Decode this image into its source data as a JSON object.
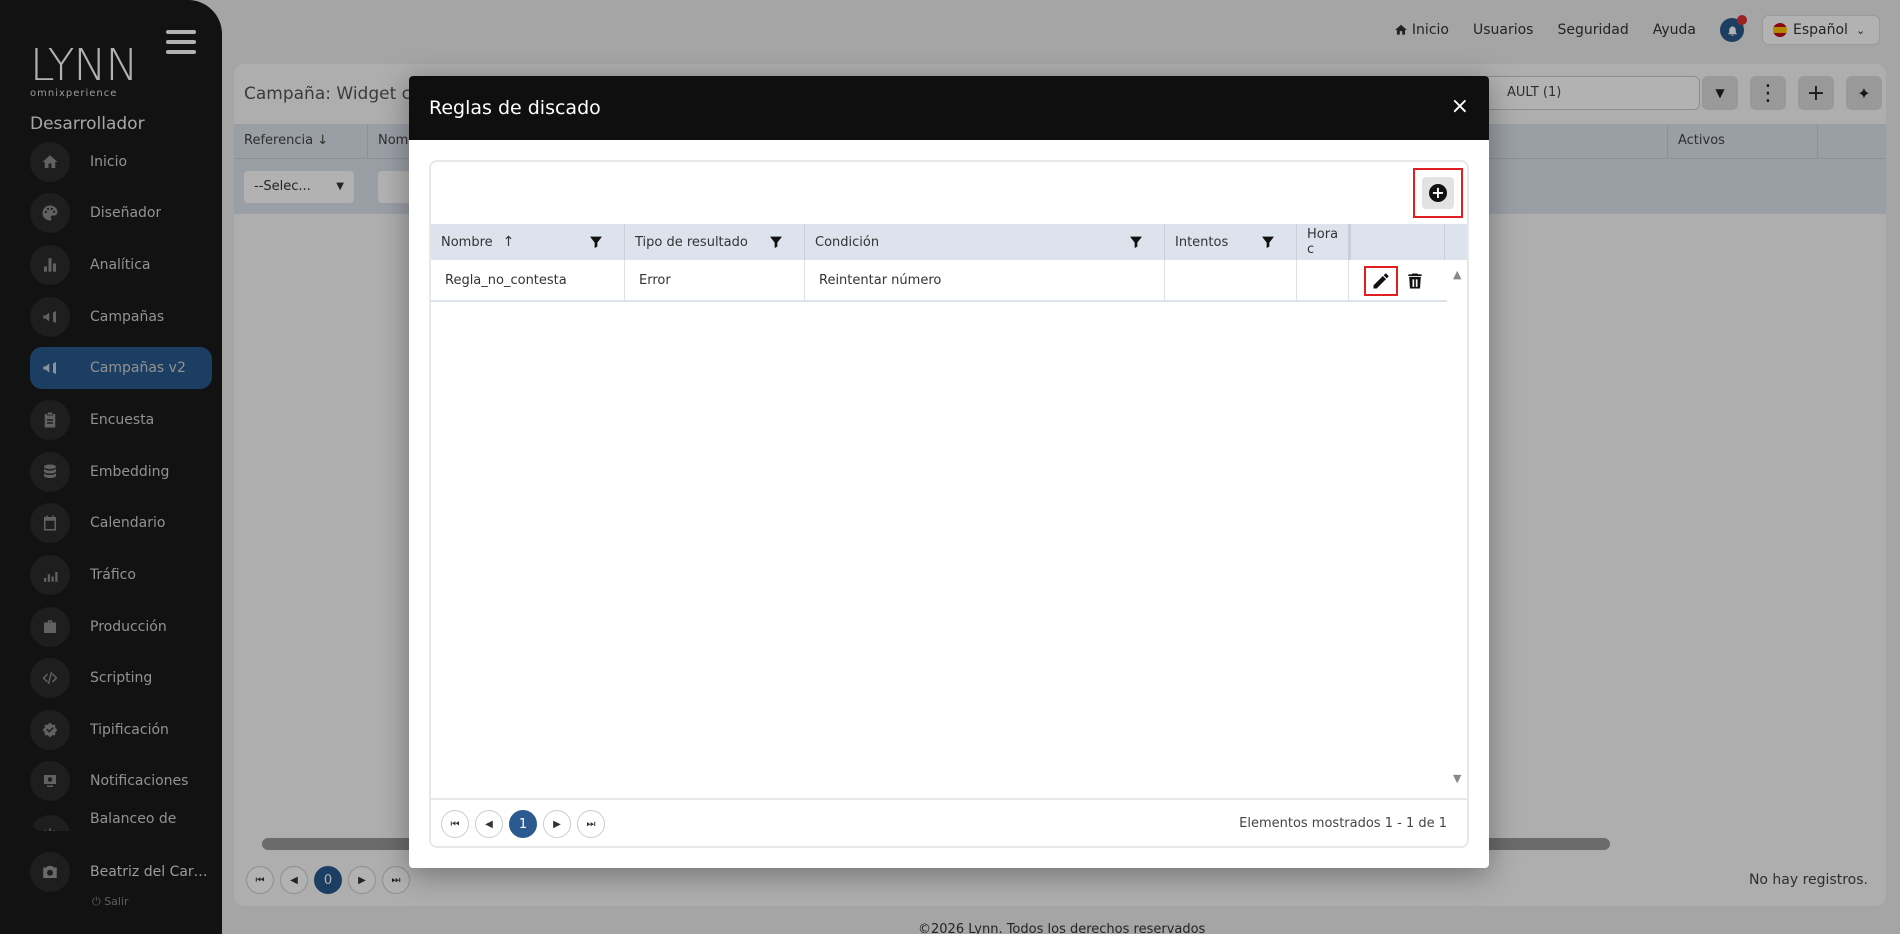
{
  "sidebar": {
    "logo_word": "LYNN",
    "logo_sub": "omnixperience",
    "role": "Desarrollador",
    "items": [
      {
        "label": "Inicio",
        "icon": "home-icon"
      },
      {
        "label": "Diseñador",
        "icon": "palette-icon"
      },
      {
        "label": "Analítica",
        "icon": "bar-chart-icon"
      },
      {
        "label": "Campañas",
        "icon": "megaphone-icon"
      },
      {
        "label": "Campañas v2",
        "icon": "megaphone-icon"
      },
      {
        "label": "Encuesta",
        "icon": "clipboard-icon"
      },
      {
        "label": "Embedding",
        "icon": "database-icon"
      },
      {
        "label": "Calendario",
        "icon": "calendar-icon"
      },
      {
        "label": "Tráfico",
        "icon": "traffic-icon"
      },
      {
        "label": "Producción",
        "icon": "briefcase-icon"
      },
      {
        "label": "Scripting",
        "icon": "code-icon"
      },
      {
        "label": "Tipificación",
        "icon": "badge-check-icon"
      },
      {
        "label": "Notificaciones",
        "icon": "notification-icon"
      },
      {
        "label": "Balanceo de",
        "icon": "balance-icon"
      }
    ],
    "active_index": 4,
    "user_name": "Beatriz del Carm...",
    "logout": "Salir"
  },
  "topnav": {
    "home": "Inicio",
    "users": "Usuarios",
    "security": "Seguridad",
    "help": "Ayuda",
    "language": "Español"
  },
  "page": {
    "title": "Campaña: Widget c",
    "select_value": "AULT (1)",
    "columns": [
      "Referencia",
      "Nom",
      "Activos"
    ],
    "filter_select": "--Selec...",
    "no_records": "No hay registros.",
    "current_page": "0"
  },
  "footer": "©2026 Lynn. Todos los derechos reservados",
  "modal": {
    "title": "Reglas de discado",
    "close": "×",
    "columns": [
      "Nombre",
      "Tipo de resultado",
      "Condición",
      "Intentos",
      "Hora c"
    ],
    "rows": [
      {
        "nombre": "Regla_no_contesta",
        "tipo": "Error",
        "condicion": "Reintentar número",
        "intentos": "",
        "hora": ""
      }
    ],
    "current_page": "1",
    "pager_info": "Elementos mostrados 1 - 1 de 1"
  },
  "colors": {
    "accent": "#2a5a8f",
    "sidebar_bg": "#1b1b1b",
    "header_bg": "#dde3ec",
    "highlight_border": "#e02020"
  }
}
